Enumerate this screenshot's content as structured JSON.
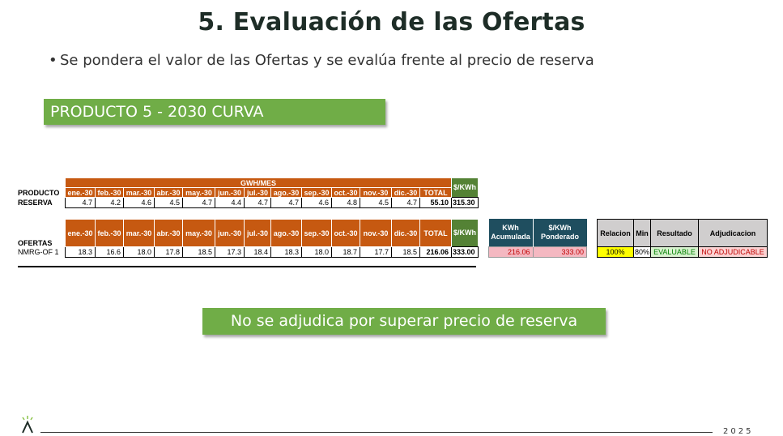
{
  "title": "5. Evaluación de las Ofertas",
  "bullet": "Se pondera el valor de las Ofertas y se evalúa frente al precio de reserva",
  "product_label": "PRODUCTO 5 -  2030 CURVA",
  "reserve_table": {
    "group_header": "GWH/MES",
    "price_header": "$/KWh",
    "months": [
      "ene.-30",
      "feb.-30",
      "mar.-30",
      "abr.-30",
      "may.-30",
      "jun.-30",
      "jul.-30",
      "ago.-30",
      "sep.-30",
      "oct.-30",
      "nov.-30",
      "dic.-30",
      "TOTAL"
    ],
    "row_label_1": "PRODUCTO",
    "row_label_2": "RESERVA",
    "values": [
      "4.7",
      "4.2",
      "4.6",
      "4.5",
      "4.7",
      "4.4",
      "4.7",
      "4.7",
      "4.6",
      "4.8",
      "4.5",
      "4.7",
      "55.10"
    ],
    "price": "315.30"
  },
  "offers_table": {
    "label": "OFERTAS",
    "months": [
      "ene.-30",
      "feb.-30",
      "mar.-30",
      "abr.-30",
      "may.-30",
      "jun.-30",
      "jul.-30",
      "ago.-30",
      "sep.-30",
      "oct.-30",
      "nov.-30",
      "dic.-30",
      "TOTAL"
    ],
    "price_header": "$/KWh",
    "row_label": "NMRG-OF 1",
    "values": [
      "18.3",
      "16.6",
      "18.0",
      "17.8",
      "18.5",
      "17.3",
      "18.4",
      "18.3",
      "18.0",
      "18.7",
      "17.7",
      "18.5",
      "216.06"
    ],
    "price": "333.00"
  },
  "weighted_table": {
    "h1_line1": "KWh",
    "h1_line2": "Acumulada",
    "h2_line1": "$/KWh",
    "h2_line2": "Ponderado",
    "kwh": "216.06",
    "price": "333.00"
  },
  "eval_table": {
    "headers": [
      "Relacion",
      "Min",
      "Resultado",
      "Adjudicacion"
    ],
    "values": [
      "100%",
      "80%",
      "EVALUABLE",
      "NO ADJUDICABLE"
    ]
  },
  "result_label": "No se adjudica por superar precio de reserva",
  "footer_year": "2025",
  "colors": {
    "accent_green": "#70ad47",
    "header_orange": "#c65911",
    "price_green": "#548235",
    "dark_teal": "#1f4e5f"
  }
}
